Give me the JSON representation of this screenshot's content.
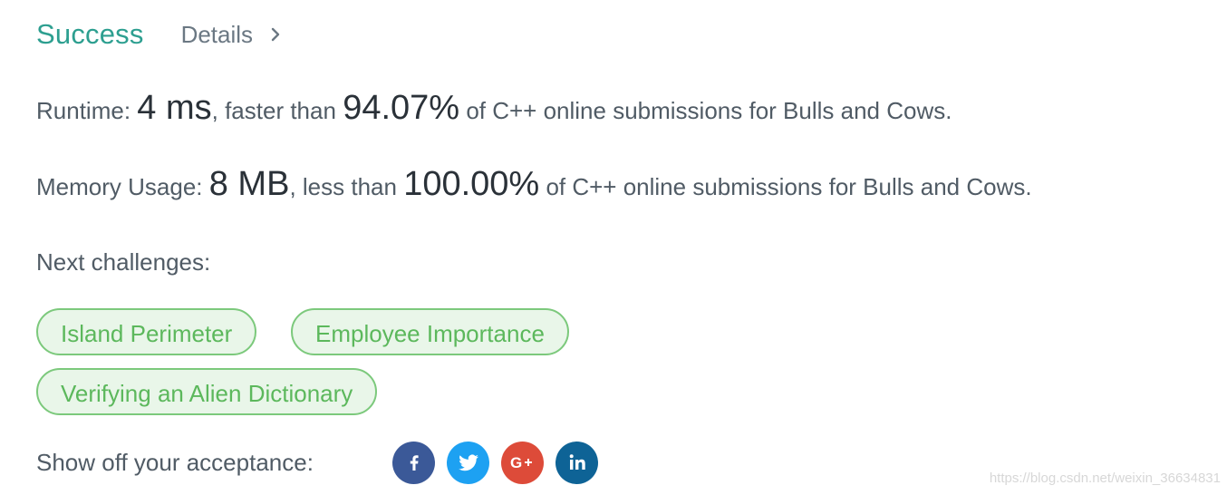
{
  "header": {
    "status": "Success",
    "details_label": "Details"
  },
  "runtime": {
    "label": "Runtime:",
    "value": "4 ms",
    "comparison": ", faster than",
    "percent": "94.07%",
    "suffix": "of C++ online submissions for Bulls and Cows."
  },
  "memory": {
    "label": "Memory Usage:",
    "value": "8 MB",
    "comparison": ", less than",
    "percent": "100.00%",
    "suffix": "of C++ online submissions for Bulls and Cows."
  },
  "next": {
    "label": "Next challenges:",
    "challenges": [
      "Island Perimeter",
      "Employee Importance",
      "Verifying an Alien Dictionary"
    ]
  },
  "share": {
    "label": "Show off your acceptance:",
    "networks": [
      {
        "icon": "facebook-icon",
        "color": "#3b5998"
      },
      {
        "icon": "twitter-icon",
        "color": "#1da1f2"
      },
      {
        "icon": "google-plus-icon",
        "color": "#dd4b39"
      },
      {
        "icon": "linkedin-icon",
        "color": "#0e6396"
      }
    ]
  },
  "watermark": "https://blog.csdn.net/weixin_36634831"
}
